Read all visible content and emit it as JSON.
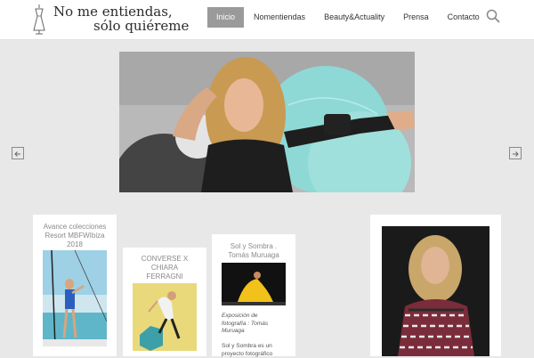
{
  "header": {
    "logo_line1": "No me entiendas,",
    "logo_line2": "sólo quiéreme",
    "logo_icon": "dress-mannequin-icon",
    "search_icon": "search-icon"
  },
  "nav": {
    "items": [
      {
        "label": "Inicio",
        "active": true
      },
      {
        "label": "Nomentiendas"
      },
      {
        "label": "Beauty&Actuality"
      },
      {
        "label": "Prensa"
      },
      {
        "label": "Contacto"
      }
    ]
  },
  "slider": {
    "prev_icon": "arrow-left-icon",
    "next_icon": "arrow-right-icon"
  },
  "cards": [
    {
      "title": "Avance colecciones Resort MBFWIbiza 2018"
    },
    {
      "title": "CONVERSE X CHIARA FERRAGNI"
    },
    {
      "title": "Sol y Sombra . Tomás Muruaga",
      "caption": "Exposición de fotografía : Tomás Muruaga",
      "text": "Sol y Sombra es un proyecto fotográfico"
    }
  ],
  "colors": {
    "background": "#e8e8e8",
    "nav_active": "#9a9a9a",
    "card_title": "#8a8a8a"
  }
}
